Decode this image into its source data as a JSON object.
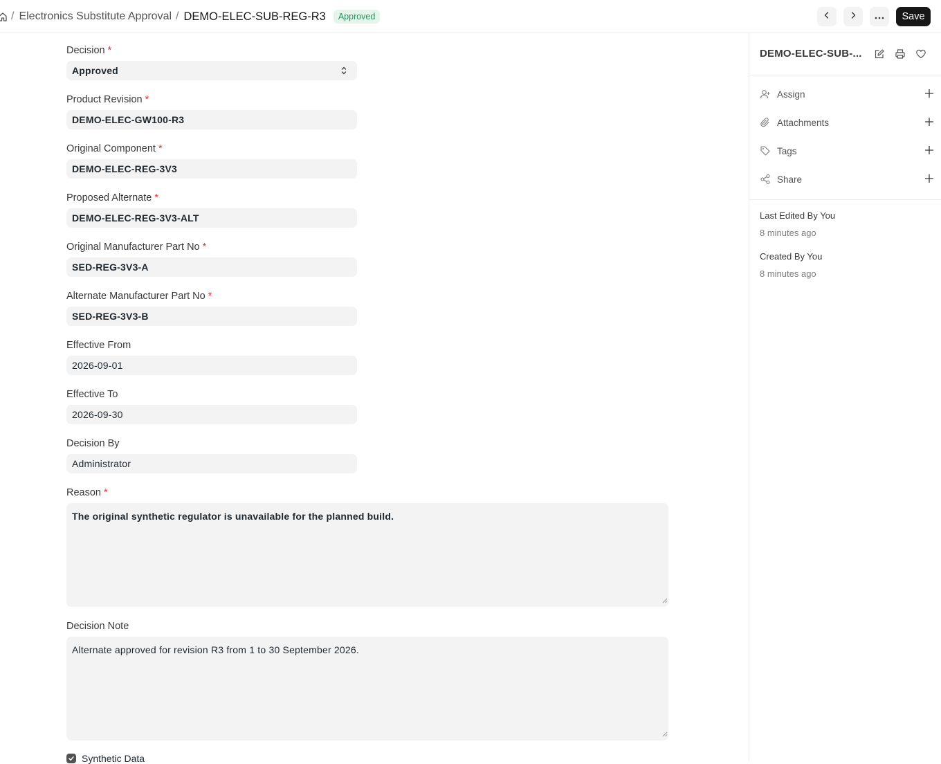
{
  "breadcrumb": {
    "separator": "/",
    "doctype": "Electronics Substitute Approval",
    "current": "DEMO-ELEC-SUB-REG-R3",
    "status": "Approved"
  },
  "toolbar": {
    "save_label": "Save",
    "icons": [
      "chevron-left-icon",
      "chevron-right-icon",
      "more-icon"
    ]
  },
  "form": {
    "decision": {
      "label": "Decision",
      "required": "*",
      "value": "Approved"
    },
    "product_revision": {
      "label": "Product Revision",
      "required": "*",
      "value": "DEMO-ELEC-GW100-R3"
    },
    "original_component": {
      "label": "Original Component",
      "required": "*",
      "value": "DEMO-ELEC-REG-3V3"
    },
    "proposed_alternate": {
      "label": "Proposed Alternate",
      "required": "*",
      "value": "DEMO-ELEC-REG-3V3-ALT"
    },
    "original_mpn": {
      "label": "Original Manufacturer Part No",
      "required": "*",
      "value": "SED-REG-3V3-A"
    },
    "alternate_mpn": {
      "label": "Alternate Manufacturer Part No",
      "required": "*",
      "value": "SED-REG-3V3-B"
    },
    "effective_from": {
      "label": "Effective From",
      "value": "2026-09-01"
    },
    "effective_to": {
      "label": "Effective To",
      "value": "2026-09-30"
    },
    "decision_by": {
      "label": "Decision By",
      "value": "Administrator"
    },
    "reason": {
      "label": "Reason",
      "required": "*",
      "value": "The original synthetic regulator is unavailable for the planned build."
    },
    "decision_note": {
      "label": "Decision Note",
      "value": "Alternate approved for revision R3 from 1 to 30 September 2026."
    },
    "synthetic_data": {
      "label": "Synthetic Data",
      "checked": true
    }
  },
  "sidebar": {
    "title": "DEMO-ELEC-SUB-...",
    "actions": [
      {
        "label": "Assign",
        "icon": "assign-icon"
      },
      {
        "label": "Attachments",
        "icon": "paperclip-icon"
      },
      {
        "label": "Tags",
        "icon": "tag-icon"
      },
      {
        "label": "Share",
        "icon": "share-icon"
      }
    ],
    "last_edited": {
      "title": "Last Edited By You",
      "time": "8 minutes ago"
    },
    "created": {
      "title": "Created By You",
      "time": "8 minutes ago"
    }
  },
  "colors": {
    "accent": "#171717",
    "badge_bg": "#e4f5e9",
    "badge_text": "#278f5e",
    "required": "#e03636",
    "control_bg": "#f3f3f3"
  }
}
